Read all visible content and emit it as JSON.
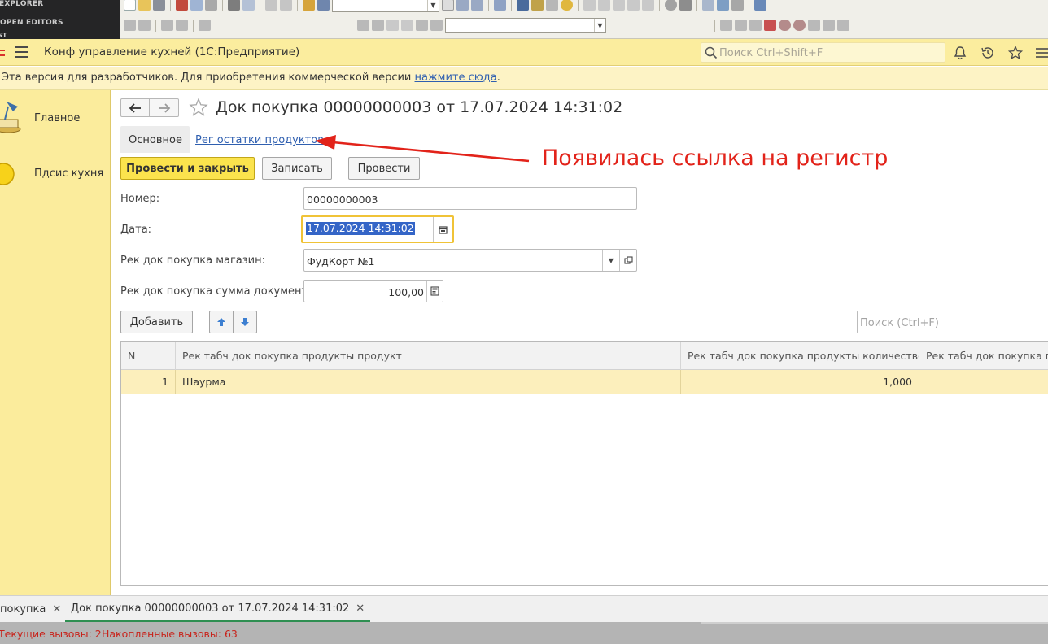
{
  "ide": {
    "explorer_title": "EXPLORER",
    "open_editors": "OPEN EDITORS",
    "section_fragment": "ST"
  },
  "app": {
    "title": "Конф управление кухней  (1С:Предприятие)",
    "search_placeholder": "Поиск Ctrl+Shift+F"
  },
  "notice": {
    "text": "Эта версия для разработчиков. Для приобретения коммерческой версии ",
    "link": "нажмите сюда",
    "suffix": "."
  },
  "sections": [
    {
      "label": "Главное",
      "icon": "desk-lamp-icon"
    },
    {
      "label": "Пдсис кухня",
      "icon": "yellow-circle-icon"
    }
  ],
  "form": {
    "title": "Док покупка 00000000003 от 17.07.2024 14:31:02",
    "tabs": {
      "main": "Основное",
      "register": "Рег остатки продуктов"
    },
    "buttons": {
      "post_close": "Провести и закрыть",
      "save": "Записать",
      "post": "Провести"
    },
    "fields": {
      "number": {
        "label": "Номер:",
        "value": "00000000003"
      },
      "date": {
        "label": "Дата:",
        "value": "17.07.2024 14:31:02"
      },
      "store": {
        "label": "Рек док покупка магазин:",
        "value": "ФудКорт №1"
      },
      "sum": {
        "label": "Рек док покупка сумма документа:",
        "value": "100,00"
      }
    },
    "table_toolbar": {
      "add": "Добавить",
      "search_placeholder": "Поиск (Ctrl+F)"
    },
    "table": {
      "columns": [
        "N",
        "Рек табч док покупка продукты продукт",
        "Рек табч док покупка продукты количество",
        "Рек табч док покупка пр"
      ],
      "rows": [
        [
          "1",
          "Шаурма",
          "1,000",
          ""
        ]
      ]
    }
  },
  "annotation": {
    "text": "Появилась ссылка на регистр",
    "color": "#e2231a"
  },
  "open_tabs": [
    "покупка",
    "Док покупка 00000000003 от 17.07.2024 14:31:02"
  ],
  "status": {
    "current_calls": "Текущие вызовы: 2",
    "accumulated_calls": "Накопленные вызовы: 63"
  },
  "colors": {
    "header_yellow": "#fbed9e",
    "primary_button": "#fbe34d",
    "link_blue": "#2f5fb0",
    "selected_row": "#fcefbc"
  }
}
